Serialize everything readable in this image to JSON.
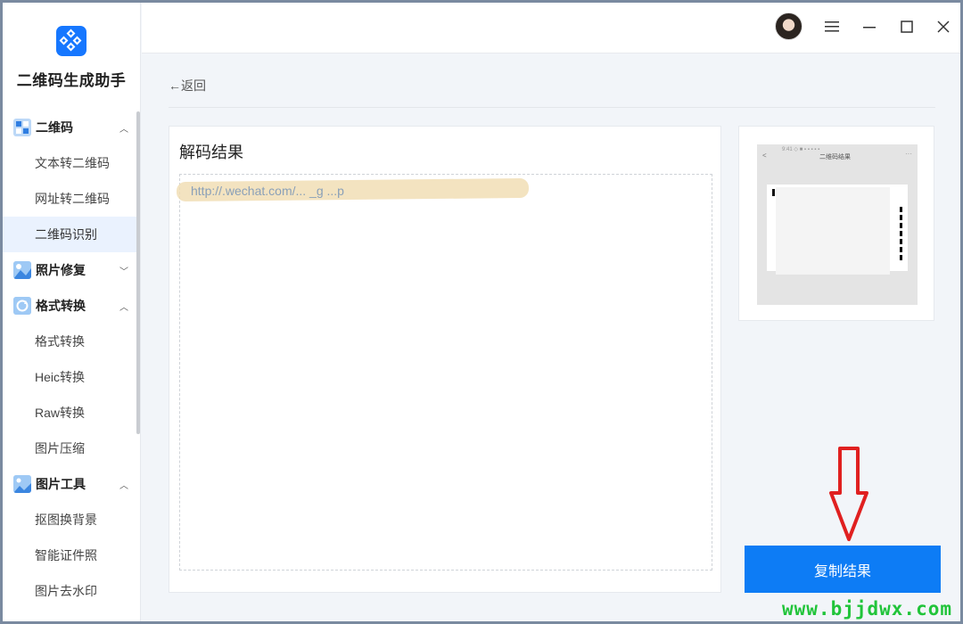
{
  "app": {
    "title": "二维码生成助手"
  },
  "sidebar": {
    "groups": [
      {
        "label": "二维码",
        "expanded": true,
        "icon": "qr-grid-icon",
        "items": [
          {
            "label": "文本转二维码",
            "active": false
          },
          {
            "label": "网址转二维码",
            "active": false
          },
          {
            "label": "二维码识别",
            "active": true
          }
        ]
      },
      {
        "label": "照片修复",
        "expanded": false,
        "icon": "photo-repair-icon",
        "items": []
      },
      {
        "label": "格式转换",
        "expanded": true,
        "icon": "format-convert-icon",
        "items": [
          {
            "label": "格式转换"
          },
          {
            "label": "Heic转换"
          },
          {
            "label": "Raw转换"
          },
          {
            "label": "图片压缩"
          }
        ]
      },
      {
        "label": "图片工具",
        "expanded": true,
        "icon": "image-tools-icon",
        "items": [
          {
            "label": "抠图换背景"
          },
          {
            "label": "智能证件照"
          },
          {
            "label": "图片去水印"
          }
        ]
      }
    ]
  },
  "titlebar": {
    "icons": [
      "avatar",
      "menu-icon",
      "minimize-icon",
      "maximize-icon",
      "close-icon"
    ]
  },
  "main": {
    "back_label": "←返回",
    "result": {
      "title": "解码结果",
      "text": "http://.wechat.com/...  _g      ...p"
    },
    "preview": {
      "back": "<",
      "header": "二维码结果",
      "dots": "···",
      "status": "9:41 ◇ ■   ▪ ▪ ▪ ▪ ▪"
    },
    "copy_button": "复制结果"
  },
  "watermark": "www.bjjdwx.com",
  "colors": {
    "accent": "#0d7cf5",
    "sidebar_active": "#eaf2fe",
    "watermark": "#21c43a",
    "arrow": "#e02020"
  }
}
